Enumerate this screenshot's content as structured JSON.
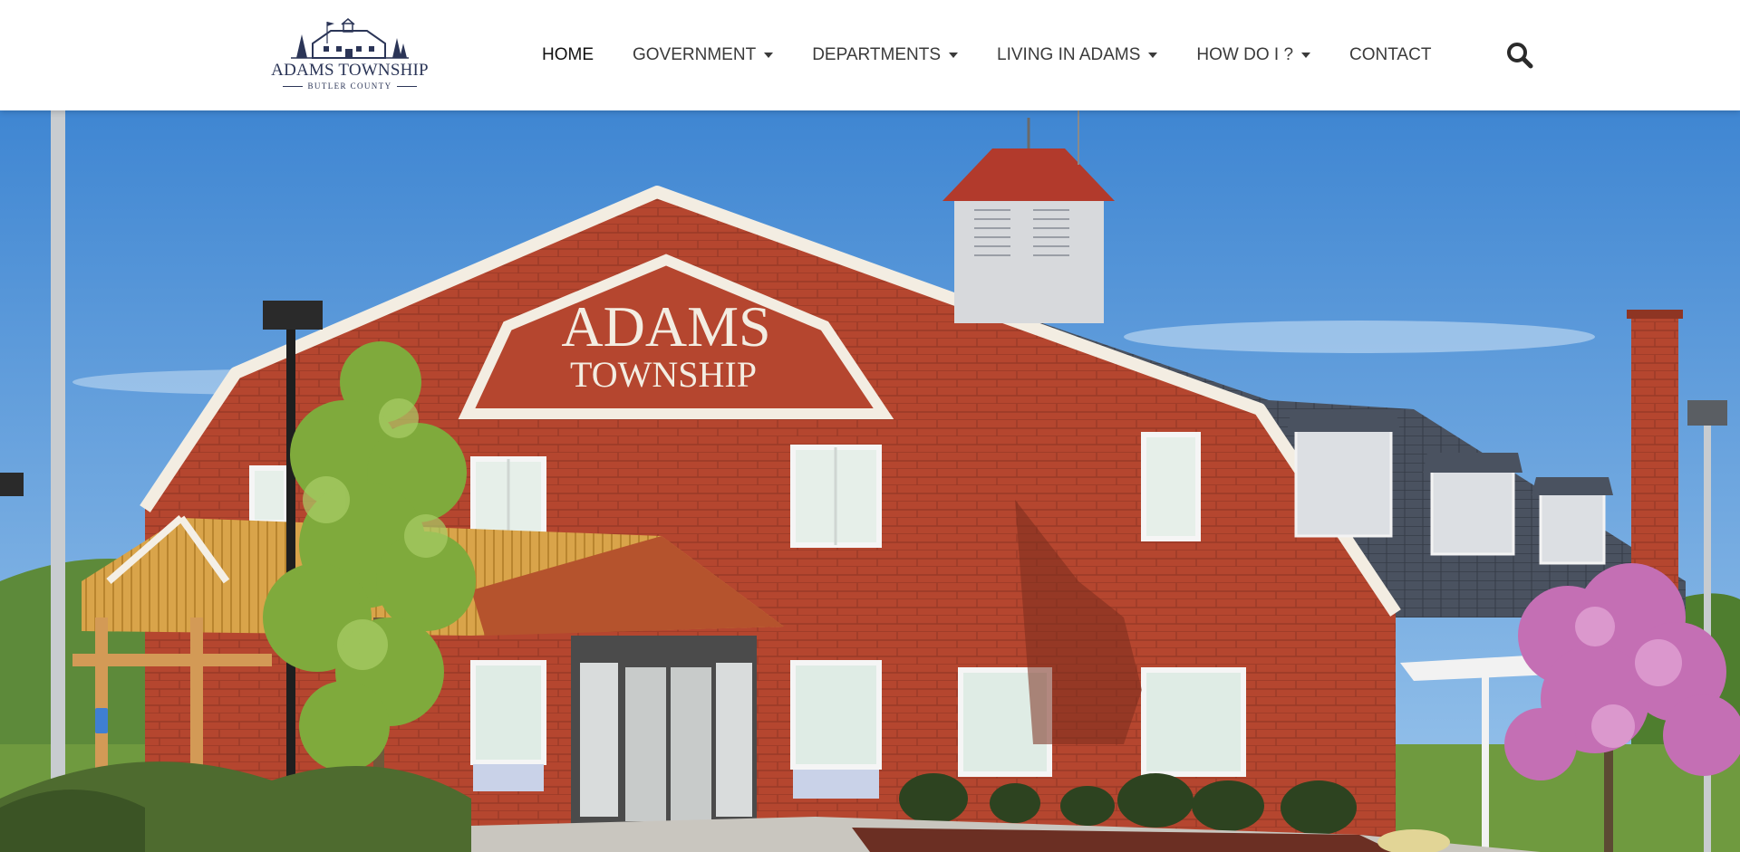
{
  "logo": {
    "title": "ADAMS TOWNSHIP",
    "subtitle": "BUTLER COUNTY",
    "icon": "barn-logo-icon"
  },
  "nav": {
    "items": [
      {
        "label": "HOME",
        "active": true,
        "has_dropdown": false
      },
      {
        "label": "GOVERNMENT",
        "active": false,
        "has_dropdown": true
      },
      {
        "label": "DEPARTMENTS",
        "active": false,
        "has_dropdown": true
      },
      {
        "label": "LIVING IN ADAMS",
        "active": false,
        "has_dropdown": true
      },
      {
        "label": "HOW DO I ?",
        "active": false,
        "has_dropdown": true
      },
      {
        "label": "CONTACT",
        "active": false,
        "has_dropdown": false
      }
    ],
    "search_icon": "search-icon"
  },
  "hero": {
    "sign_line1": "ADAMS",
    "sign_line2": "TOWNSHIP"
  },
  "colors": {
    "brand_navy": "#2b3557",
    "brick": "#b5462f",
    "sky": "#4f93d6",
    "roof": "#4a5260",
    "awning": "#d9a44a"
  }
}
